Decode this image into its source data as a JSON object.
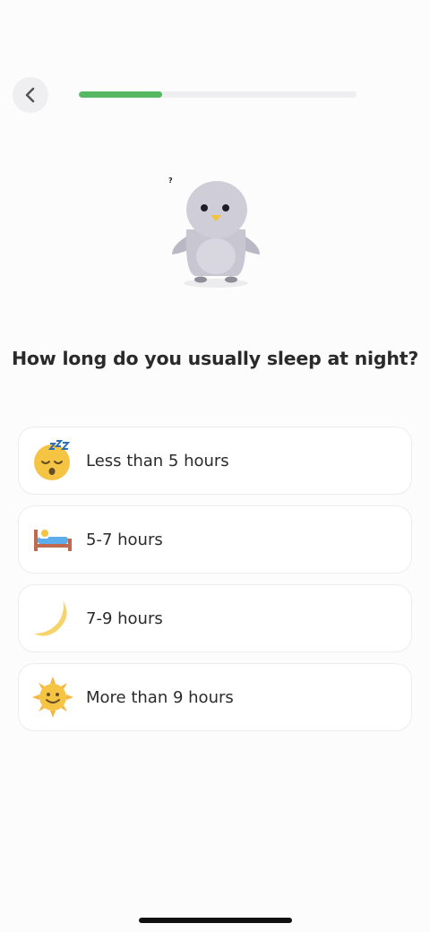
{
  "header": {
    "back_icon": "chevron-left-icon",
    "progress": 0.3
  },
  "mascot": {
    "icon": "penguin-mascot",
    "thought_mark": "?"
  },
  "question": "How long do you usually sleep at night?",
  "options": [
    {
      "label": "Less than 5 hours",
      "icon": "sleeping-face-emoji"
    },
    {
      "label": "5-7 hours",
      "icon": "person-in-bed-emoji"
    },
    {
      "label": "7-9 hours",
      "icon": "crescent-moon-emoji"
    },
    {
      "label": "More than 9 hours",
      "icon": "sun-with-face-emoji"
    }
  ],
  "colors": {
    "accent": "#56b863",
    "track": "#efeef0",
    "card_border": "#ecebee"
  }
}
